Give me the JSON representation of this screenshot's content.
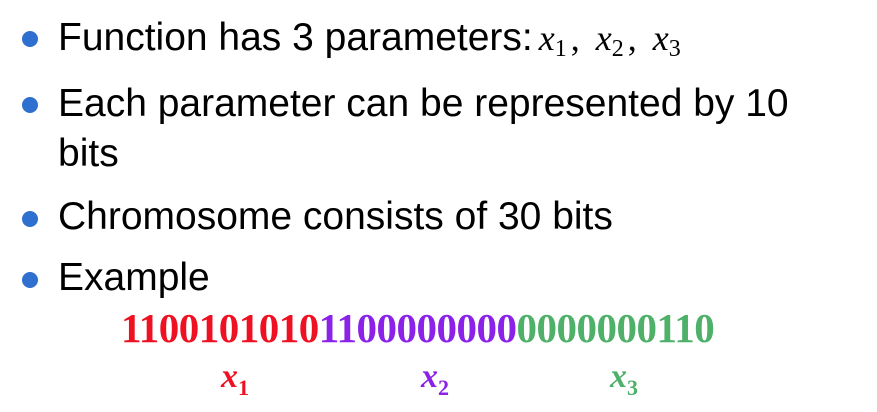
{
  "colors": {
    "bullet": "#2f6fd0",
    "x1": "#ee1122",
    "x2": "#8a22e8",
    "x3": "#4fb06a"
  },
  "bullets": [
    {
      "text": "Function has 3 parameters:",
      "math": [
        {
          "var": "x",
          "sub": "1",
          "sep": ","
        },
        {
          "var": "x",
          "sub": "2",
          "sep": ","
        },
        {
          "var": "x",
          "sub": "3",
          "sep": ""
        }
      ]
    },
    {
      "text": "Each parameter can be represented by 10 bits"
    },
    {
      "text": "Chromosome consists of 30 bits"
    },
    {
      "text": "Example"
    }
  ],
  "example": {
    "segments": [
      "1100101010",
      "1100000000",
      "0000000110"
    ],
    "labels": [
      {
        "var": "x",
        "sub": "1"
      },
      {
        "var": "x",
        "sub": "2"
      },
      {
        "var": "x",
        "sub": "3"
      }
    ]
  }
}
